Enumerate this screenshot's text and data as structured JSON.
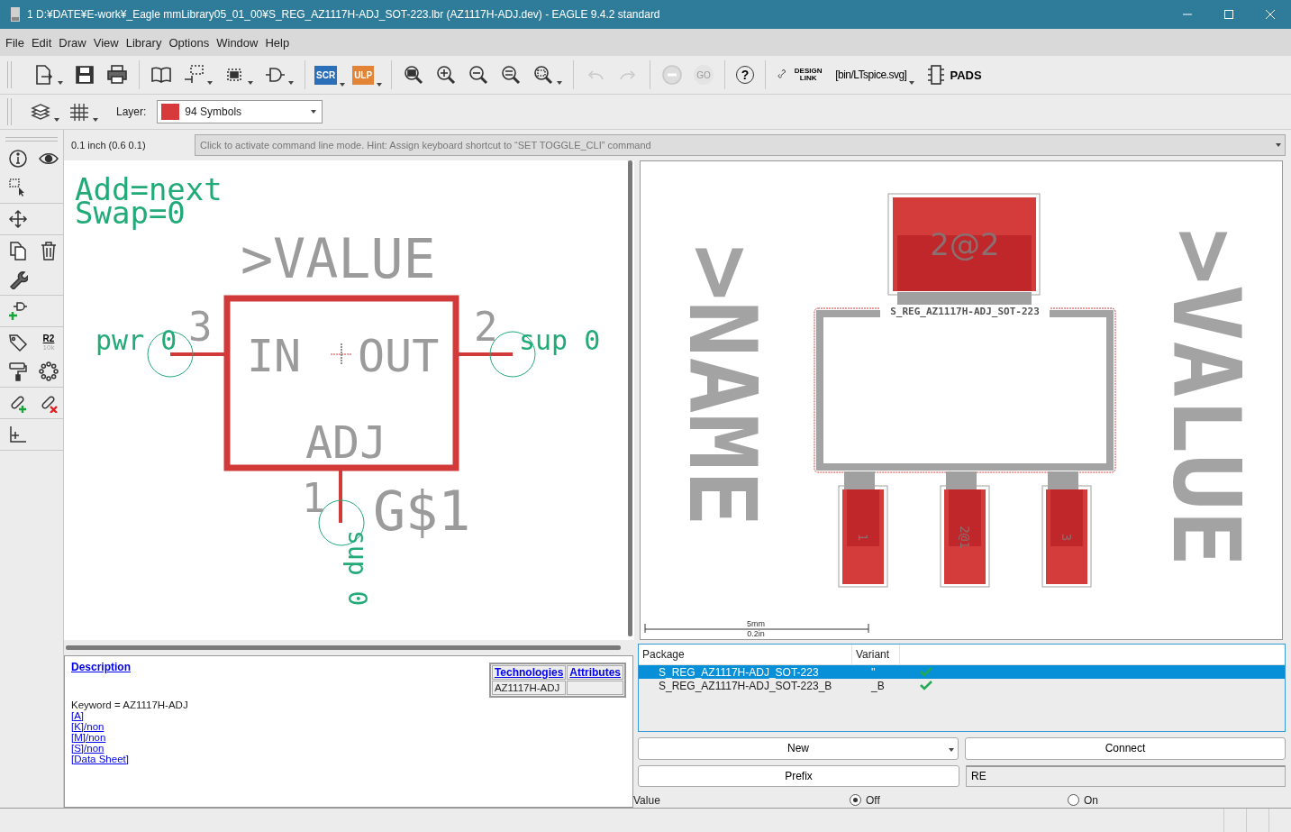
{
  "window": {
    "title": "1 D:¥DATE¥E-work¥_Eagle mmLibrary05_01_00¥S_REG_AZ1117H-ADJ_SOT-223.lbr (AZ1117H-ADJ.dev) - EAGLE 9.4.2 standard"
  },
  "menu": [
    "File",
    "Edit",
    "Draw",
    "View",
    "Library",
    "Options",
    "Window",
    "Help"
  ],
  "toolbar": [
    [
      {
        "kind": "new",
        "disabled": false,
        "dropdown": true
      },
      {
        "kind": "save",
        "disabled": false,
        "dropdown": false
      },
      {
        "kind": "print",
        "disabled": false,
        "dropdown": false
      }
    ],
    [
      {
        "kind": "library",
        "disabled": false,
        "dropdown": false
      },
      {
        "kind": "pinout",
        "disabled": false,
        "dropdown": true
      },
      {
        "kind": "chip",
        "disabled": false,
        "dropdown": true
      },
      {
        "kind": "gate",
        "disabled": false,
        "dropdown": true
      }
    ],
    [
      {
        "kind": "scr",
        "label": "SCR",
        "disabled": false,
        "dropdown": true
      },
      {
        "kind": "ulp",
        "label": "ULP",
        "disabled": false,
        "dropdown": true
      }
    ],
    [
      {
        "kind": "zoom-fit",
        "disabled": false,
        "dropdown": false
      },
      {
        "kind": "zoom-in",
        "disabled": false,
        "dropdown": false
      },
      {
        "kind": "zoom-out",
        "disabled": false,
        "dropdown": false
      },
      {
        "kind": "redraw",
        "disabled": false,
        "dropdown": false
      },
      {
        "kind": "zoom-select",
        "disabled": false,
        "dropdown": true
      }
    ],
    [
      {
        "kind": "undo",
        "disabled": true,
        "dropdown": false
      },
      {
        "kind": "redo",
        "disabled": true,
        "dropdown": false
      }
    ],
    [
      {
        "kind": "stop",
        "disabled": true,
        "dropdown": false
      },
      {
        "kind": "go",
        "label": "GO",
        "disabled": true,
        "dropdown": false
      }
    ],
    [
      {
        "kind": "help",
        "label": "?",
        "disabled": false,
        "dropdown": false
      }
    ],
    [
      {
        "kind": "designlink",
        "label": "DESIGN LINK",
        "disabled": false,
        "dropdown": false
      },
      {
        "kind": "file",
        "label": "[bin/LTspice.svg]",
        "disabled": false,
        "dropdown": true
      },
      {
        "kind": "pads",
        "label": "PADS",
        "disabled": false,
        "dropdown": false
      }
    ]
  ],
  "layer_bar": {
    "label": "Layer:",
    "value": "94 Symbols"
  },
  "value_tool": {
    "label": "R2",
    "sublabel": "10k"
  },
  "grid_readout": "0.1 inch (0.6 0.1)",
  "command_line": {
    "placeholder": "Click to activate command line mode. Hint: Assign keyboard shortcut to “SET TOGGLE_CLI” command"
  },
  "symbol": {
    "info": [
      "Add=next",
      "Swap=0"
    ],
    "value": ">VALUE",
    "name": "G$1",
    "pins": [
      {
        "kind": "left",
        "number": "3",
        "net": "pwr 0",
        "label": "IN"
      },
      {
        "kind": "right",
        "number": "2",
        "net": "sup 0",
        "label": "OUT"
      },
      {
        "kind": "bottom",
        "number": "1",
        "net": "sup 0",
        "label": "ADJ"
      }
    ]
  },
  "footprint": {
    "name": ">NAME",
    "value": ">VALUE",
    "package": "S_REG_AZ1117H-ADJ_SOT-223",
    "tab": "2@2",
    "pads": [
      "1",
      "2@1",
      "3"
    ],
    "scale": [
      "5mm",
      "0.2in"
    ]
  },
  "description": {
    "title": "Description",
    "keyword": "Keyword = AZ1117H-ADJ",
    "links": [
      "[A]",
      "[K]/non",
      "[M]/non",
      "[S]/non",
      "[Data Sheet]"
    ],
    "table": {
      "columns": [
        "Technologies",
        "Attributes"
      ],
      "rows": [
        [
          "AZ1117H-ADJ",
          ""
        ]
      ]
    }
  },
  "packages": {
    "columns": [
      "Package",
      "Variant"
    ],
    "rows": [
      {
        "package": "S_REG_AZ1117H-ADJ_SOT-223",
        "variant": "''",
        "checked": true,
        "selected": true
      },
      {
        "package": "S_REG_AZ1117H-ADJ_SOT-223_B",
        "variant": "_B",
        "checked": true,
        "selected": false
      }
    ]
  },
  "buttons": {
    "new": "New",
    "connect": "Connect",
    "prefix": "Prefix"
  },
  "prefix_value": "RE",
  "value_setting": {
    "label": "Value",
    "options": [
      {
        "label": "Off",
        "selected": true
      },
      {
        "label": "On",
        "selected": false
      }
    ]
  }
}
